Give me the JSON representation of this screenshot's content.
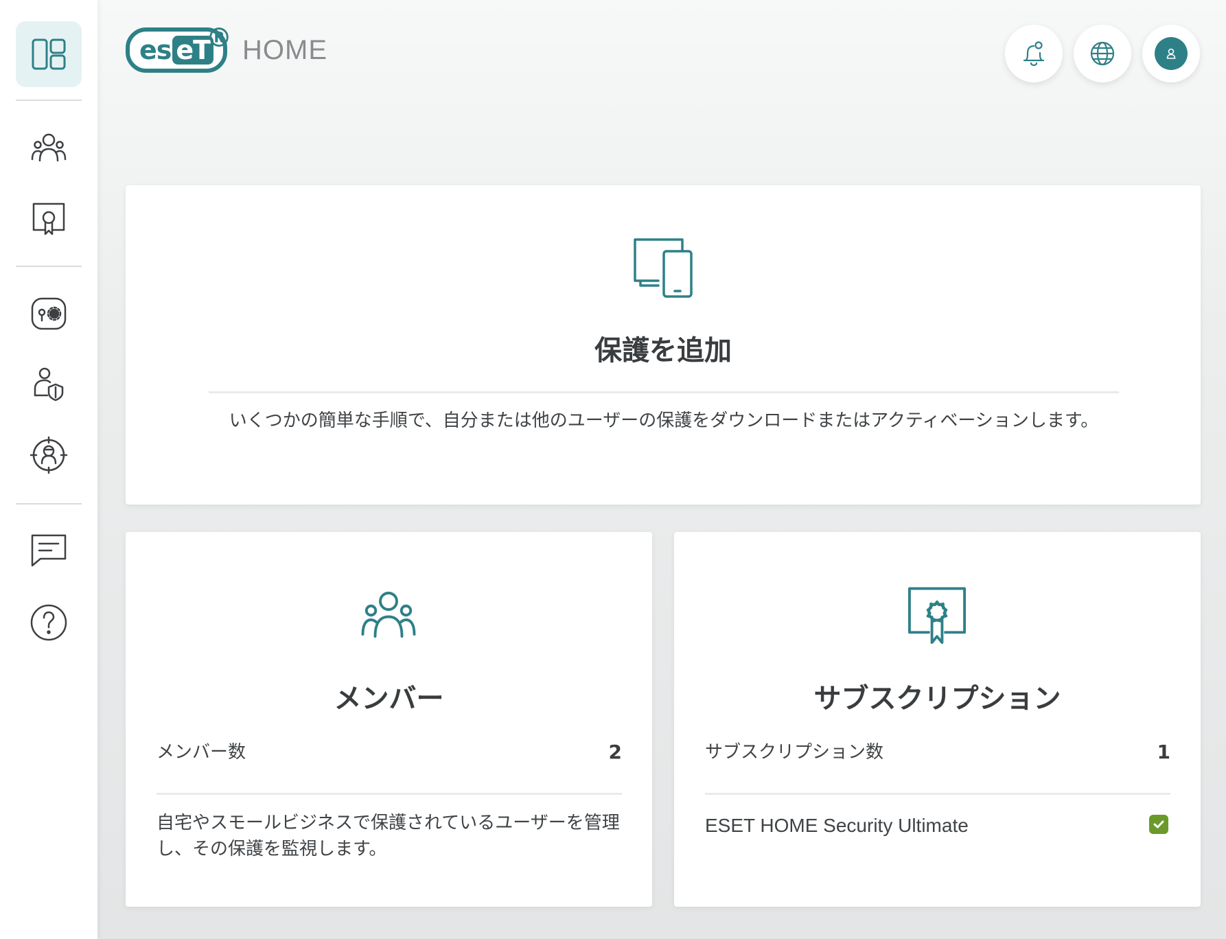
{
  "app": {
    "logo_text_left": "es",
    "logo_text_right": "eT",
    "logo_registered": "®",
    "product_name": "HOME",
    "brand_color": "#2e8087"
  },
  "sidebar": {
    "items": [
      {
        "icon": "dashboard-icon",
        "active": true
      },
      {
        "icon": "members-icon",
        "active": false
      },
      {
        "icon": "subscription-certificate-icon",
        "active": false
      },
      {
        "icon": "device-settings-icon",
        "active": false
      },
      {
        "icon": "user-shield-icon",
        "active": false
      },
      {
        "icon": "anti-theft-icon",
        "active": false
      },
      {
        "icon": "messages-icon",
        "active": false
      },
      {
        "icon": "help-icon",
        "active": false
      }
    ]
  },
  "header": {
    "buttons": [
      {
        "icon": "notification-bell-icon"
      },
      {
        "icon": "globe-icon"
      },
      {
        "icon": "user-avatar-icon"
      }
    ]
  },
  "add_protection_card": {
    "icon": "devices-icon",
    "title": "保護を追加",
    "description": "いくつかの簡単な手順で、自分または他のユーザーの保護をダウンロードまたはアクティベーションします。"
  },
  "members_card": {
    "icon": "members-icon",
    "title": "メンバー",
    "count_label": "メンバー数",
    "count_value": "2",
    "description": "自宅やスモールビジネスで保護されているユーザーを管理し、その保護を監視します。"
  },
  "subscriptions_card": {
    "icon": "subscription-certificate-icon",
    "title": "サブスクリプション",
    "count_label": "サブスクリプション数",
    "count_value": "1",
    "subscription_name": "ESET HOME Security Ultimate",
    "status_icon": "check-icon",
    "status_color": "#6a9a2a"
  }
}
